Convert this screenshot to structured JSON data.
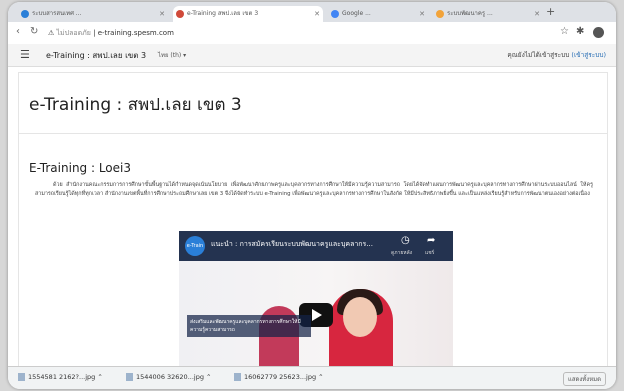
{
  "browser": {
    "tabs": [
      {
        "label": "ระบบสารสนเทศ ...",
        "color": "#2a7fd8",
        "active": false
      },
      {
        "label": "e-Training สพป.เลย เขต 3",
        "color": "#d04a3a",
        "active": true
      },
      {
        "label": "Google ...",
        "color": "#4285f4",
        "active": false
      },
      {
        "label": "ระบบพัฒนาครู ...",
        "color": "#f2a33a",
        "active": false
      }
    ],
    "new_tab": "+",
    "url_host": "ไม่ปลอดภัย",
    "url_path": "e-training.spesm.com",
    "star": "☆"
  },
  "site": {
    "brand": "e-Training : สพป.เลย เขต 3",
    "lang": "ไทย (th) ▾",
    "login_prompt": "คุณยังไม่ได้เข้าสู่ระบบ",
    "login_link": "(เข้าสู่ระบบ)"
  },
  "page": {
    "title": "e-Training : สพป.เลย เขต 3",
    "section_title": "E-Training : Loei3",
    "paragraph": "ด้วย สำนักงานคณะกรรมการการศึกษาขั้นพื้นฐานได้กำหนดจุดเน้นนโยบาย เพื่อพัฒนาศักยภาพครูและบุคลากรทางการศึกษาให้มีความรู้ความสามารถ โดยได้จัดทำแผนการพัฒนาครูและบุคลากรทางการศึกษาผ่านระบบออนไลน์ ให้ครูสามารถเรียนรู้ได้ทุกที่ทุกเวลา สำนักงานเขตพื้นที่การศึกษาประถมศึกษาเลย เขต 3 จึงได้จัดทำระบบ e-Training เพื่อพัฒนาครูและบุคลากรทางการศึกษาในสังกัด ให้มีประสิทธิภาพยิ่งขึ้น และเป็นแหล่งเรียนรู้สำหรับการพัฒนาตนเองอย่างต่อเนื่อง",
    "video": {
      "logo": "e-Train",
      "title": "แนะนำ : การสมัครเรียนระบบพัฒนาครูและบุคลากร...",
      "watch_later": "ดูภายหลัง",
      "share": "แชร์",
      "caption": "ส่งเสริมและพัฒนาครูและบุคลากรทางการศึกษาให้มีความรู้ความสามารถ"
    }
  },
  "downloads": [
    {
      "name": "1554581 2162?...jpg"
    },
    {
      "name": "1544006 32620...jpg"
    },
    {
      "name": "16062779 25623...jpg"
    }
  ],
  "downloads_show_all": "แสดงทั้งหมด"
}
